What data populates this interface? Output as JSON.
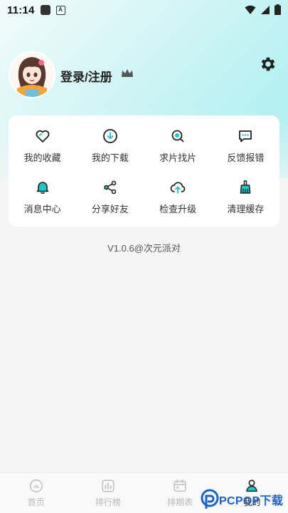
{
  "status_bar": {
    "time": "11:14"
  },
  "profile": {
    "login_label": "登录/注册"
  },
  "menu": {
    "items": [
      {
        "label": "我的收藏",
        "icon": "heart-icon"
      },
      {
        "label": "我的下载",
        "icon": "download-icon"
      },
      {
        "label": "求片找片",
        "icon": "search-film-icon"
      },
      {
        "label": "反馈报错",
        "icon": "feedback-icon"
      },
      {
        "label": "消息中心",
        "icon": "bell-icon"
      },
      {
        "label": "分享好友",
        "icon": "share-icon"
      },
      {
        "label": "检查升级",
        "icon": "cloud-upload-icon"
      },
      {
        "label": "清理缓存",
        "icon": "broom-icon"
      }
    ]
  },
  "version": "V1.0.6@次元派对",
  "tabbar": {
    "tabs": [
      {
        "label": "首页",
        "icon": "home-icon",
        "active": false
      },
      {
        "label": "排行榜",
        "icon": "ranking-icon",
        "active": false
      },
      {
        "label": "排期表",
        "icon": "calendar-icon",
        "active": false
      },
      {
        "label": "我的",
        "icon": "profile-icon",
        "active": true
      }
    ]
  },
  "watermark": {
    "text": "PCPOP下载"
  },
  "colors": {
    "accent": "#1cc6c9",
    "gradient_end": "#a6eef0",
    "text_dark": "#222222"
  }
}
